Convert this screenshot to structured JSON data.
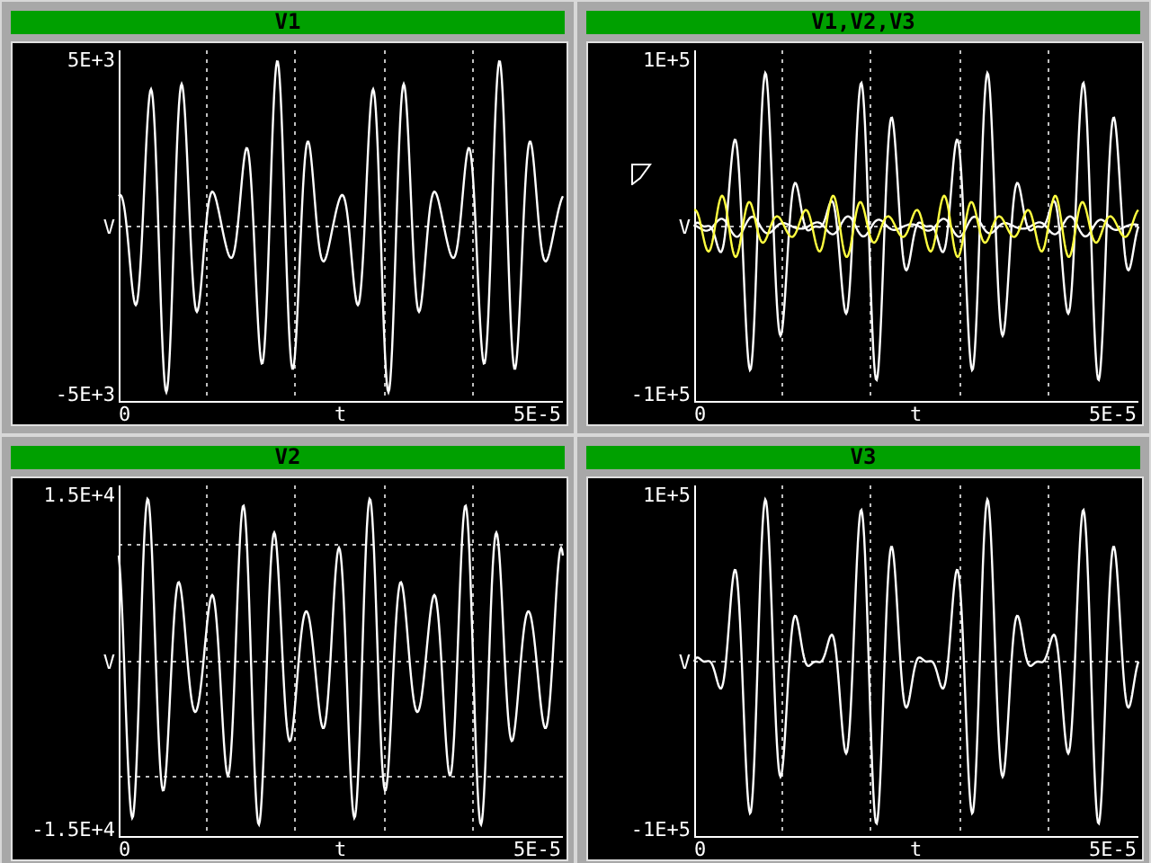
{
  "panels": [
    {
      "title": "V1",
      "y_max": "5E+3",
      "y_unit": "V",
      "y_min": "-5E+3",
      "x_min": "0",
      "x_label": "t",
      "x_max": "5E-5"
    },
    {
      "title": "V1,V2,V3",
      "y_max": "1E+5",
      "y_unit": "V",
      "y_min": "-1E+5",
      "x_min": "0",
      "x_label": "t",
      "x_max": "5E-5"
    },
    {
      "title": "V2",
      "y_max": "1.5E+4",
      "y_unit": "V",
      "y_min": "-1.5E+4",
      "x_min": "0",
      "x_label": "t",
      "x_max": "5E-5"
    },
    {
      "title": "V3",
      "y_max": "1E+5",
      "y_unit": "V",
      "y_min": "-1E+5",
      "x_min": "0",
      "x_label": "t",
      "x_max": "5E-5"
    }
  ]
}
